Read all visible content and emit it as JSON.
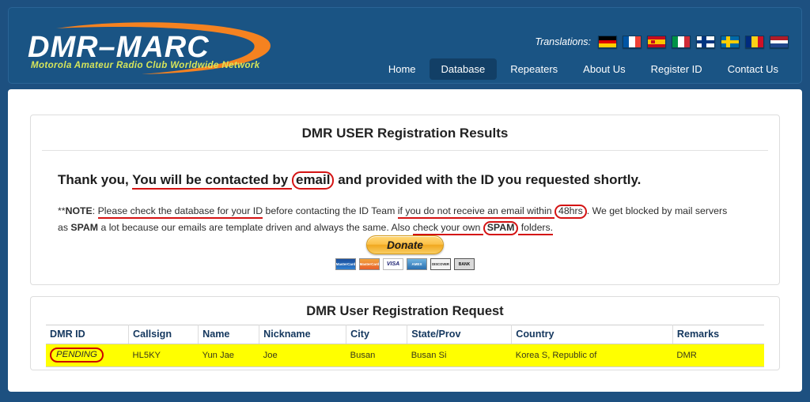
{
  "site": {
    "logo_title": "DMR-MARC",
    "logo_tagline": "Motorola Amateur Radio Club Worldwide Network"
  },
  "header": {
    "translations_label": "Translations:",
    "flags": [
      {
        "name": "flag-germany",
        "country": "Germany"
      },
      {
        "name": "flag-france",
        "country": "France"
      },
      {
        "name": "flag-spain",
        "country": "Spain"
      },
      {
        "name": "flag-italy",
        "country": "Italy"
      },
      {
        "name": "flag-finland",
        "country": "Finland"
      },
      {
        "name": "flag-sweden",
        "country": "Sweden"
      },
      {
        "name": "flag-romania",
        "country": "Romania"
      },
      {
        "name": "flag-netherlands",
        "country": "Netherlands"
      }
    ],
    "nav": [
      {
        "label": "Home",
        "active": false
      },
      {
        "label": "Database",
        "active": true
      },
      {
        "label": "Repeaters",
        "active": false
      },
      {
        "label": "About Us",
        "active": false
      },
      {
        "label": "Register ID",
        "active": false
      },
      {
        "label": "Contact Us",
        "active": false
      }
    ]
  },
  "results_card": {
    "title": "DMR USER Registration Results",
    "thankyou": {
      "lead": "Thank you, ",
      "underlined_1": "You will be contacted by ",
      "boxed_1": "email",
      "tail": " and provided with the ID you requested shortly."
    },
    "note": {
      "stars": "**",
      "label": "NOTE",
      "colon": ": ",
      "underlined_1": "Please check the database for your ID",
      "mid_1": " before contacting the ID Team ",
      "underlined_2": "if you do not receive an email within ",
      "boxed_1": "48hrs",
      "tail_1": ". We get blocked by mail servers",
      "line2_pre": "as ",
      "line2_bold": "SPAM",
      "line2_mid": " a lot because our emails are template driven and always the same. Also ",
      "underlined_3a": "check your own ",
      "boxed_2": "SPAM",
      "underlined_3b": " folders."
    },
    "donate": {
      "label": "Donate",
      "cards": [
        "MasterCard",
        "MasterCard",
        "VISA",
        "AMEX",
        "DISCOVER",
        "BANK"
      ]
    }
  },
  "request_card": {
    "title": "DMR User Registration Request",
    "columns": [
      "DMR ID",
      "Callsign",
      "Name",
      "Nickname",
      "City",
      "State/Prov",
      "Country",
      "Remarks"
    ],
    "rows": [
      {
        "dmr_id": "PENDING",
        "callsign": "HL5KY",
        "name": "Yun Jae",
        "nickname": "Joe",
        "city": "Busan",
        "state_prov": "Busan Si",
        "country": "Korea S, Republic of",
        "remarks": "DMR"
      }
    ]
  },
  "colors": {
    "page_frame": "#1d5080",
    "header_bg": "#1a5484",
    "nav_active": "#123f66",
    "annotation_red": "#d41313",
    "row_highlight": "#ffff00",
    "table_header_text": "#14375e",
    "logo_orange": "#f58220",
    "logo_tagline": "#d7e65a"
  }
}
